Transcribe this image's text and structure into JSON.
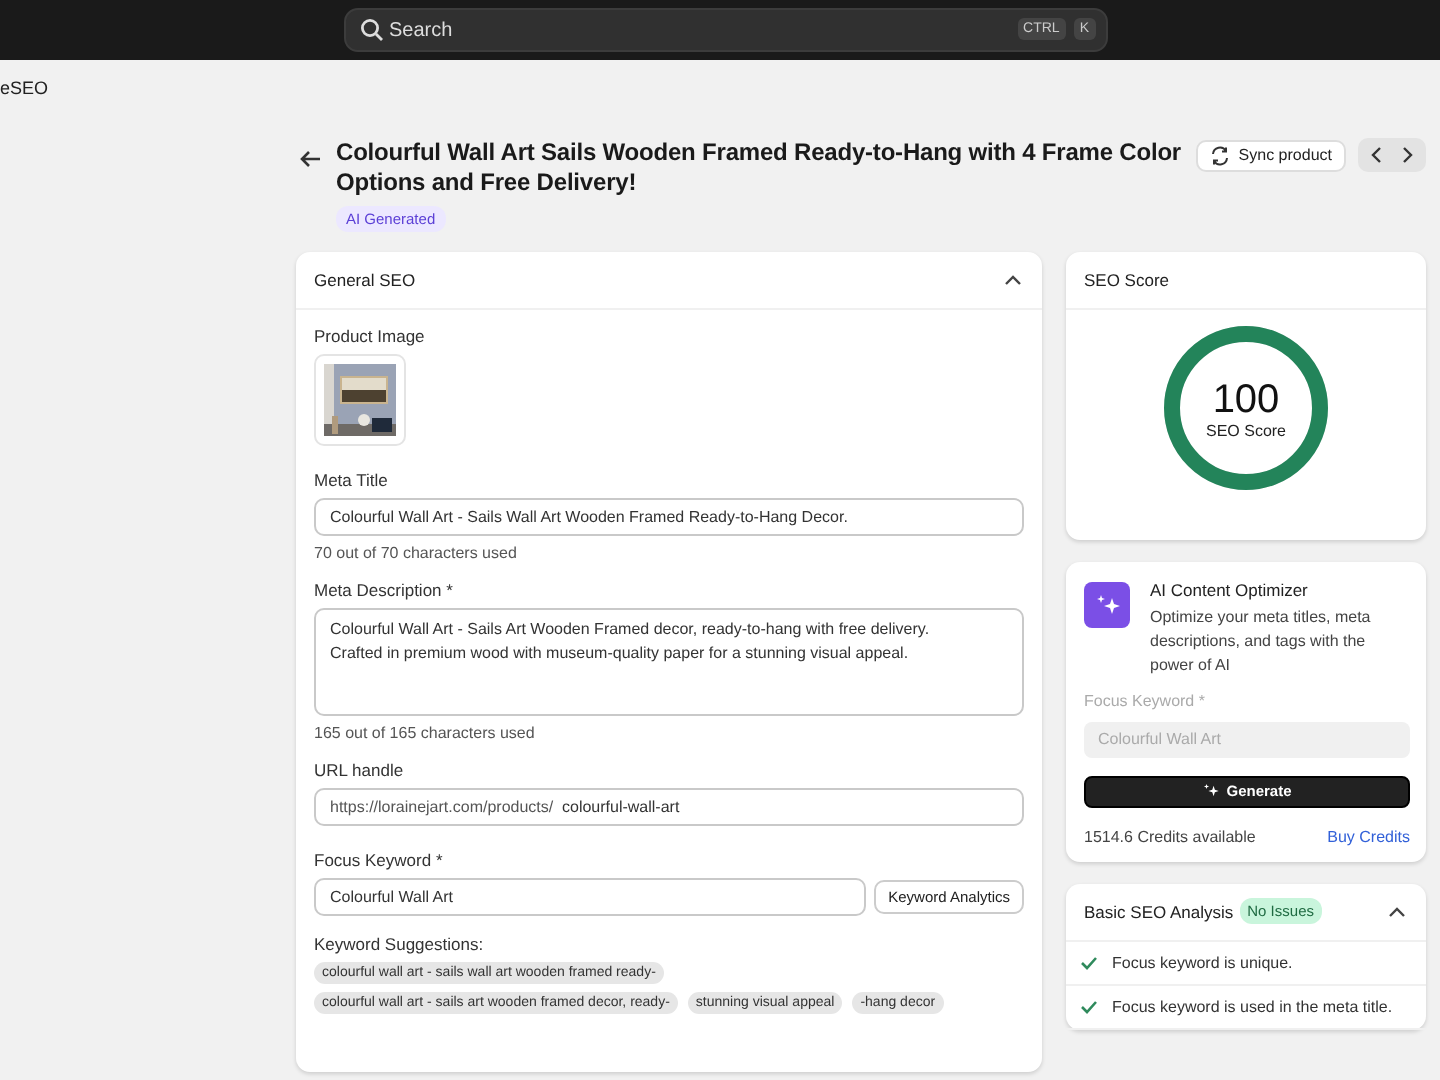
{
  "topbar": {
    "search": {
      "placeholder": "Search"
    },
    "shortcut": [
      "CTRL",
      "K"
    ]
  },
  "app_name": "eSEO",
  "header": {
    "title": "Colourful Wall Art Sails Wooden Framed Ready-to-Hang with 4 Frame Color Options and Free Delivery!",
    "badge": "AI Generated",
    "sync_button": "Sync product"
  },
  "general_seo": {
    "title": "General SEO",
    "expanded": true,
    "product_image": {
      "label": "Product Image",
      "kind": "picture"
    },
    "meta_title": {
      "label": "Meta Title",
      "value": "Colourful Wall Art - Sails Wall Art Wooden Framed Ready-to-Hang Decor.",
      "hint": "70 out of 70 characters used"
    },
    "meta_description": {
      "label": "Meta Description *",
      "value": "Colourful Wall Art - Sails Art Wooden Framed decor, ready-to-hang with free delivery. Crafted in premium wood with museum-quality paper for a stunning visual appeal.",
      "hint": "165 out of 165 characters used"
    },
    "url_handle": {
      "label": "URL handle",
      "prefix": "https://lorainejart.com/products/",
      "value": "colourful-wall-art"
    },
    "focus_keyword": {
      "label": "Focus Keyword *",
      "value": "Colourful Wall Art",
      "button": "Keyword Analytics"
    },
    "keyword_suggestions": {
      "label": "Keyword Suggestions:",
      "items": [
        "colourful wall art - sails wall art wooden framed ready-",
        "colourful wall art - sails art wooden framed decor, ready-",
        "stunning visual appeal",
        "-hang decor"
      ]
    }
  },
  "seo_score": {
    "title": "SEO Score",
    "value": "100",
    "label": "SEO Score",
    "level": 1
  },
  "ai_optimizer": {
    "title": "AI Content Optimizer",
    "description": "Optimize your meta titles, meta descriptions, and tags with the power of AI",
    "focus_keyword": {
      "label": "Focus Keyword *",
      "placeholder": "Colourful Wall Art"
    },
    "button": "Generate",
    "credits": "1514.6 Credits available",
    "link": "Buy Credits"
  },
  "analysis": {
    "title": "Basic SEO Analysis",
    "badge": "No Issues",
    "expanded": true,
    "items": [
      {
        "text": "Focus keyword is unique.",
        "passed": true
      },
      {
        "text": "Focus keyword is used in the meta title.",
        "passed": true
      }
    ]
  }
}
